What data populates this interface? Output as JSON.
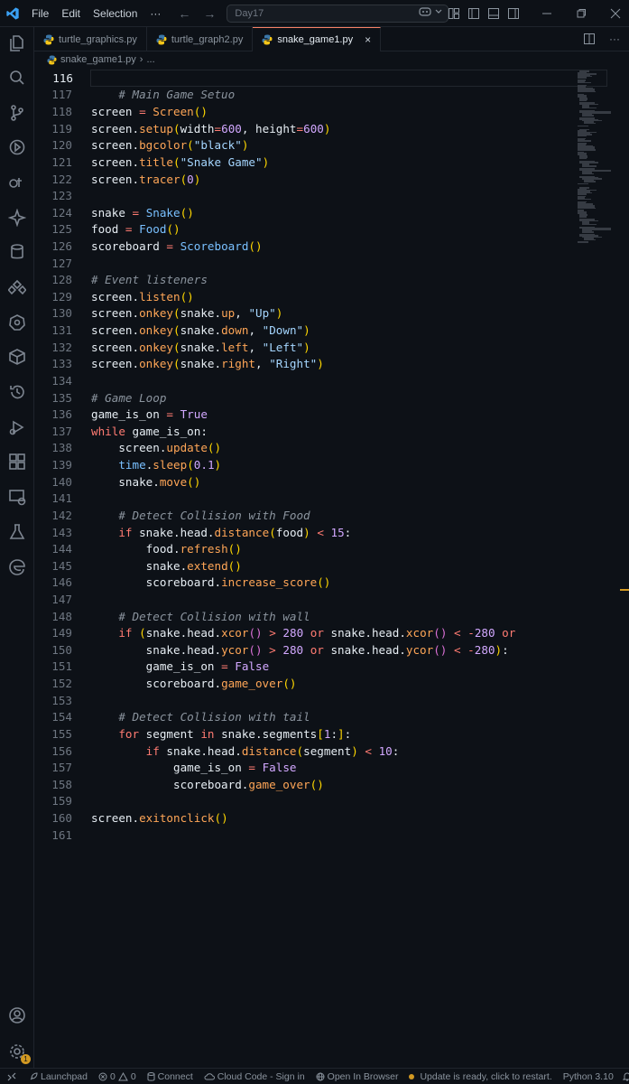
{
  "titlebar": {
    "menu": [
      "File",
      "Edit",
      "Selection",
      "···"
    ],
    "search_text": "Day17"
  },
  "tabs": [
    {
      "label": "turtle_graphics.py",
      "active": false
    },
    {
      "label": "turtle_graph2.py",
      "active": false
    },
    {
      "label": "snake_game1.py",
      "active": true
    }
  ],
  "breadcrumb": {
    "file": "snake_game1.py",
    "rest": "..."
  },
  "editor": {
    "current_line": 116,
    "lines": [
      {
        "n": "116",
        "tokens": []
      },
      {
        "n": "117",
        "tokens": [
          [
            "t-com",
            "    # Main Game Setuo"
          ]
        ]
      },
      {
        "n": "118",
        "tokens": [
          [
            "t-default",
            "screen "
          ],
          [
            "t-op",
            "="
          ],
          [
            "t-default",
            " "
          ],
          [
            "t-fn",
            "Screen"
          ],
          [
            "t-paren1",
            "()"
          ]
        ]
      },
      {
        "n": "119",
        "tokens": [
          [
            "t-default",
            "screen."
          ],
          [
            "t-fn",
            "setup"
          ],
          [
            "t-paren1",
            "("
          ],
          [
            "t-default",
            "width"
          ],
          [
            "t-op",
            "="
          ],
          [
            "t-num",
            "600"
          ],
          [
            "t-default",
            ", height"
          ],
          [
            "t-op",
            "="
          ],
          [
            "t-num",
            "600"
          ],
          [
            "t-paren1",
            ")"
          ]
        ]
      },
      {
        "n": "120",
        "tokens": [
          [
            "t-default",
            "screen."
          ],
          [
            "t-fn",
            "bgcolor"
          ],
          [
            "t-paren1",
            "("
          ],
          [
            "t-str",
            "\"black\""
          ],
          [
            "t-paren1",
            ")"
          ]
        ]
      },
      {
        "n": "121",
        "tokens": [
          [
            "t-default",
            "screen."
          ],
          [
            "t-fn",
            "title"
          ],
          [
            "t-paren1",
            "("
          ],
          [
            "t-str",
            "\"Snake Game\""
          ],
          [
            "t-paren1",
            ")"
          ]
        ]
      },
      {
        "n": "122",
        "tokens": [
          [
            "t-default",
            "screen."
          ],
          [
            "t-fn",
            "tracer"
          ],
          [
            "t-paren1",
            "("
          ],
          [
            "t-num",
            "0"
          ],
          [
            "t-paren1",
            ")"
          ]
        ]
      },
      {
        "n": "123",
        "tokens": []
      },
      {
        "n": "124",
        "tokens": [
          [
            "t-default",
            "snake "
          ],
          [
            "t-op",
            "="
          ],
          [
            "t-default",
            " "
          ],
          [
            "t-cls",
            "Snake"
          ],
          [
            "t-paren1",
            "()"
          ]
        ]
      },
      {
        "n": "125",
        "tokens": [
          [
            "t-default",
            "food "
          ],
          [
            "t-op",
            "="
          ],
          [
            "t-default",
            " "
          ],
          [
            "t-cls",
            "Food"
          ],
          [
            "t-paren1",
            "()"
          ]
        ]
      },
      {
        "n": "126",
        "tokens": [
          [
            "t-default",
            "scoreboard "
          ],
          [
            "t-op",
            "="
          ],
          [
            "t-default",
            " "
          ],
          [
            "t-cls",
            "Scoreboard"
          ],
          [
            "t-paren1",
            "()"
          ]
        ]
      },
      {
        "n": "127",
        "tokens": []
      },
      {
        "n": "128",
        "tokens": [
          [
            "t-com",
            "# Event listeners"
          ]
        ]
      },
      {
        "n": "129",
        "tokens": [
          [
            "t-default",
            "screen."
          ],
          [
            "t-fn",
            "listen"
          ],
          [
            "t-paren1",
            "()"
          ]
        ]
      },
      {
        "n": "130",
        "tokens": [
          [
            "t-default",
            "screen."
          ],
          [
            "t-fn",
            "onkey"
          ],
          [
            "t-paren1",
            "("
          ],
          [
            "t-default",
            "snake."
          ],
          [
            "t-fn",
            "up"
          ],
          [
            "t-default",
            ", "
          ],
          [
            "t-str",
            "\"Up\""
          ],
          [
            "t-paren1",
            ")"
          ]
        ]
      },
      {
        "n": "131",
        "tokens": [
          [
            "t-default",
            "screen."
          ],
          [
            "t-fn",
            "onkey"
          ],
          [
            "t-paren1",
            "("
          ],
          [
            "t-default",
            "snake."
          ],
          [
            "t-fn",
            "down"
          ],
          [
            "t-default",
            ", "
          ],
          [
            "t-str",
            "\"Down\""
          ],
          [
            "t-paren1",
            ")"
          ]
        ]
      },
      {
        "n": "132",
        "tokens": [
          [
            "t-default",
            "screen."
          ],
          [
            "t-fn",
            "onkey"
          ],
          [
            "t-paren1",
            "("
          ],
          [
            "t-default",
            "snake."
          ],
          [
            "t-fn",
            "left"
          ],
          [
            "t-default",
            ", "
          ],
          [
            "t-str",
            "\"Left\""
          ],
          [
            "t-paren1",
            ")"
          ]
        ]
      },
      {
        "n": "133",
        "tokens": [
          [
            "t-default",
            "screen."
          ],
          [
            "t-fn",
            "onkey"
          ],
          [
            "t-paren1",
            "("
          ],
          [
            "t-default",
            "snake."
          ],
          [
            "t-fn",
            "right"
          ],
          [
            "t-default",
            ", "
          ],
          [
            "t-str",
            "\"Right\""
          ],
          [
            "t-paren1",
            ")"
          ]
        ]
      },
      {
        "n": "134",
        "tokens": []
      },
      {
        "n": "135",
        "tokens": [
          [
            "t-com",
            "# Game Loop"
          ]
        ]
      },
      {
        "n": "136",
        "tokens": [
          [
            "t-default",
            "game_is_on "
          ],
          [
            "t-op",
            "="
          ],
          [
            "t-default",
            " "
          ],
          [
            "t-bool",
            "True"
          ]
        ]
      },
      {
        "n": "137",
        "tokens": [
          [
            "t-kw",
            "while"
          ],
          [
            "t-default",
            " game_is_on:"
          ]
        ]
      },
      {
        "n": "138",
        "tokens": [
          [
            "t-default",
            "    screen."
          ],
          [
            "t-fn",
            "update"
          ],
          [
            "t-paren1",
            "()"
          ]
        ]
      },
      {
        "n": "139",
        "tokens": [
          [
            "t-default",
            "    "
          ],
          [
            "t-builtin",
            "time"
          ],
          [
            "t-default",
            "."
          ],
          [
            "t-fn",
            "sleep"
          ],
          [
            "t-paren1",
            "("
          ],
          [
            "t-num",
            "0.1"
          ],
          [
            "t-paren1",
            ")"
          ]
        ]
      },
      {
        "n": "140",
        "tokens": [
          [
            "t-default",
            "    snake."
          ],
          [
            "t-fn",
            "move"
          ],
          [
            "t-paren1",
            "()"
          ]
        ]
      },
      {
        "n": "141",
        "tokens": []
      },
      {
        "n": "142",
        "tokens": [
          [
            "t-com",
            "    # Detect Collision with Food"
          ]
        ]
      },
      {
        "n": "143",
        "tokens": [
          [
            "t-default",
            "    "
          ],
          [
            "t-kw",
            "if"
          ],
          [
            "t-default",
            " snake.head."
          ],
          [
            "t-fn",
            "distance"
          ],
          [
            "t-paren1",
            "("
          ],
          [
            "t-default",
            "food"
          ],
          [
            "t-paren1",
            ")"
          ],
          [
            "t-default",
            " "
          ],
          [
            "t-op",
            "<"
          ],
          [
            "t-default",
            " "
          ],
          [
            "t-num",
            "15"
          ],
          [
            "t-default",
            ":"
          ]
        ]
      },
      {
        "n": "144",
        "tokens": [
          [
            "t-default",
            "        food."
          ],
          [
            "t-fn",
            "refresh"
          ],
          [
            "t-paren1",
            "()"
          ]
        ]
      },
      {
        "n": "145",
        "tokens": [
          [
            "t-default",
            "        snake."
          ],
          [
            "t-fn",
            "extend"
          ],
          [
            "t-paren1",
            "()"
          ]
        ]
      },
      {
        "n": "146",
        "tokens": [
          [
            "t-default",
            "        scoreboard."
          ],
          [
            "t-fn",
            "increase_score"
          ],
          [
            "t-paren1",
            "()"
          ]
        ]
      },
      {
        "n": "147",
        "tokens": []
      },
      {
        "n": "148",
        "tokens": [
          [
            "t-com",
            "    # Detect Collision with wall"
          ]
        ]
      },
      {
        "n": "149",
        "tokens": [
          [
            "t-default",
            "    "
          ],
          [
            "t-kw",
            "if"
          ],
          [
            "t-default",
            " "
          ],
          [
            "t-paren1",
            "("
          ],
          [
            "t-default",
            "snake.head."
          ],
          [
            "t-fn",
            "xcor"
          ],
          [
            "t-paren2",
            "()"
          ],
          [
            "t-default",
            " "
          ],
          [
            "t-op",
            ">"
          ],
          [
            "t-default",
            " "
          ],
          [
            "t-num",
            "280"
          ],
          [
            "t-default",
            " "
          ],
          [
            "t-kw",
            "or"
          ],
          [
            "t-default",
            " snake.head."
          ],
          [
            "t-fn",
            "xcor"
          ],
          [
            "t-paren2",
            "()"
          ],
          [
            "t-default",
            " "
          ],
          [
            "t-op",
            "<"
          ],
          [
            "t-default",
            " "
          ],
          [
            "t-op",
            "-"
          ],
          [
            "t-num",
            "280"
          ],
          [
            "t-default",
            " "
          ],
          [
            "t-kw",
            "or"
          ]
        ]
      },
      {
        "n": "150",
        "tokens": [
          [
            "t-default",
            "        snake.head."
          ],
          [
            "t-fn",
            "ycor"
          ],
          [
            "t-paren2",
            "()"
          ],
          [
            "t-default",
            " "
          ],
          [
            "t-op",
            ">"
          ],
          [
            "t-default",
            " "
          ],
          [
            "t-num",
            "280"
          ],
          [
            "t-default",
            " "
          ],
          [
            "t-kw",
            "or"
          ],
          [
            "t-default",
            " snake.head."
          ],
          [
            "t-fn",
            "ycor"
          ],
          [
            "t-paren2",
            "()"
          ],
          [
            "t-default",
            " "
          ],
          [
            "t-op",
            "<"
          ],
          [
            "t-default",
            " "
          ],
          [
            "t-op",
            "-"
          ],
          [
            "t-num",
            "280"
          ],
          [
            "t-paren1",
            ")"
          ],
          [
            "t-default",
            ":"
          ]
        ]
      },
      {
        "n": "151",
        "tokens": [
          [
            "t-default",
            "        game_is_on "
          ],
          [
            "t-op",
            "="
          ],
          [
            "t-default",
            " "
          ],
          [
            "t-bool",
            "False"
          ]
        ]
      },
      {
        "n": "152",
        "tokens": [
          [
            "t-default",
            "        scoreboard."
          ],
          [
            "t-fn",
            "game_over"
          ],
          [
            "t-paren1",
            "()"
          ]
        ]
      },
      {
        "n": "153",
        "tokens": []
      },
      {
        "n": "154",
        "tokens": [
          [
            "t-com",
            "    # Detect Collision with tail"
          ]
        ]
      },
      {
        "n": "155",
        "tokens": [
          [
            "t-default",
            "    "
          ],
          [
            "t-kw",
            "for"
          ],
          [
            "t-default",
            " segment "
          ],
          [
            "t-kw",
            "in"
          ],
          [
            "t-default",
            " snake.segments"
          ],
          [
            "t-paren1",
            "["
          ],
          [
            "t-num",
            "1"
          ],
          [
            "t-default",
            ":"
          ],
          [
            "t-paren1",
            "]"
          ],
          [
            "t-default",
            ":"
          ]
        ]
      },
      {
        "n": "156",
        "tokens": [
          [
            "t-default",
            "        "
          ],
          [
            "t-kw",
            "if"
          ],
          [
            "t-default",
            " snake.head."
          ],
          [
            "t-fn",
            "distance"
          ],
          [
            "t-paren1",
            "("
          ],
          [
            "t-default",
            "segment"
          ],
          [
            "t-paren1",
            ")"
          ],
          [
            "t-default",
            " "
          ],
          [
            "t-op",
            "<"
          ],
          [
            "t-default",
            " "
          ],
          [
            "t-num",
            "10"
          ],
          [
            "t-default",
            ":"
          ]
        ]
      },
      {
        "n": "157",
        "tokens": [
          [
            "t-default",
            "            game_is_on "
          ],
          [
            "t-op",
            "="
          ],
          [
            "t-default",
            " "
          ],
          [
            "t-bool",
            "False"
          ]
        ]
      },
      {
        "n": "158",
        "tokens": [
          [
            "t-default",
            "            scoreboard."
          ],
          [
            "t-fn",
            "game_over"
          ],
          [
            "t-paren1",
            "()"
          ]
        ]
      },
      {
        "n": "159",
        "tokens": []
      },
      {
        "n": "160",
        "tokens": [
          [
            "t-default",
            "screen."
          ],
          [
            "t-fn",
            "exitonclick"
          ],
          [
            "t-paren1",
            "()"
          ]
        ]
      },
      {
        "n": "161",
        "tokens": []
      }
    ]
  },
  "statusbar": {
    "launchpad": "Launchpad",
    "errors": "0",
    "warnings": "0",
    "connect": "Connect",
    "cloud_code": "Cloud Code - Sign in",
    "open_browser": "Open In Browser",
    "update": "Update is ready, click to restart.",
    "python": "Python 3.10"
  },
  "activity_icons": [
    "explorer-icon",
    "search-icon",
    "source-control-icon",
    "run-debug-icon",
    "gitlens-icon",
    "copilot-icon",
    "database-icon",
    "extensions-icon",
    "kubernetes-icon",
    "package-icon",
    "timeline-icon",
    "testing-icon",
    "remote-icon",
    "remote-explorer-icon",
    "flask-icon",
    "edge-icon"
  ],
  "colors": {
    "background": "#0d1117",
    "keyword": "#ff7b72",
    "function": "#ffa657",
    "class": "#79c0ff",
    "string": "#a5d6ff",
    "number": "#d2a8ff",
    "comment": "#8b949e",
    "accent": "#f78166"
  }
}
